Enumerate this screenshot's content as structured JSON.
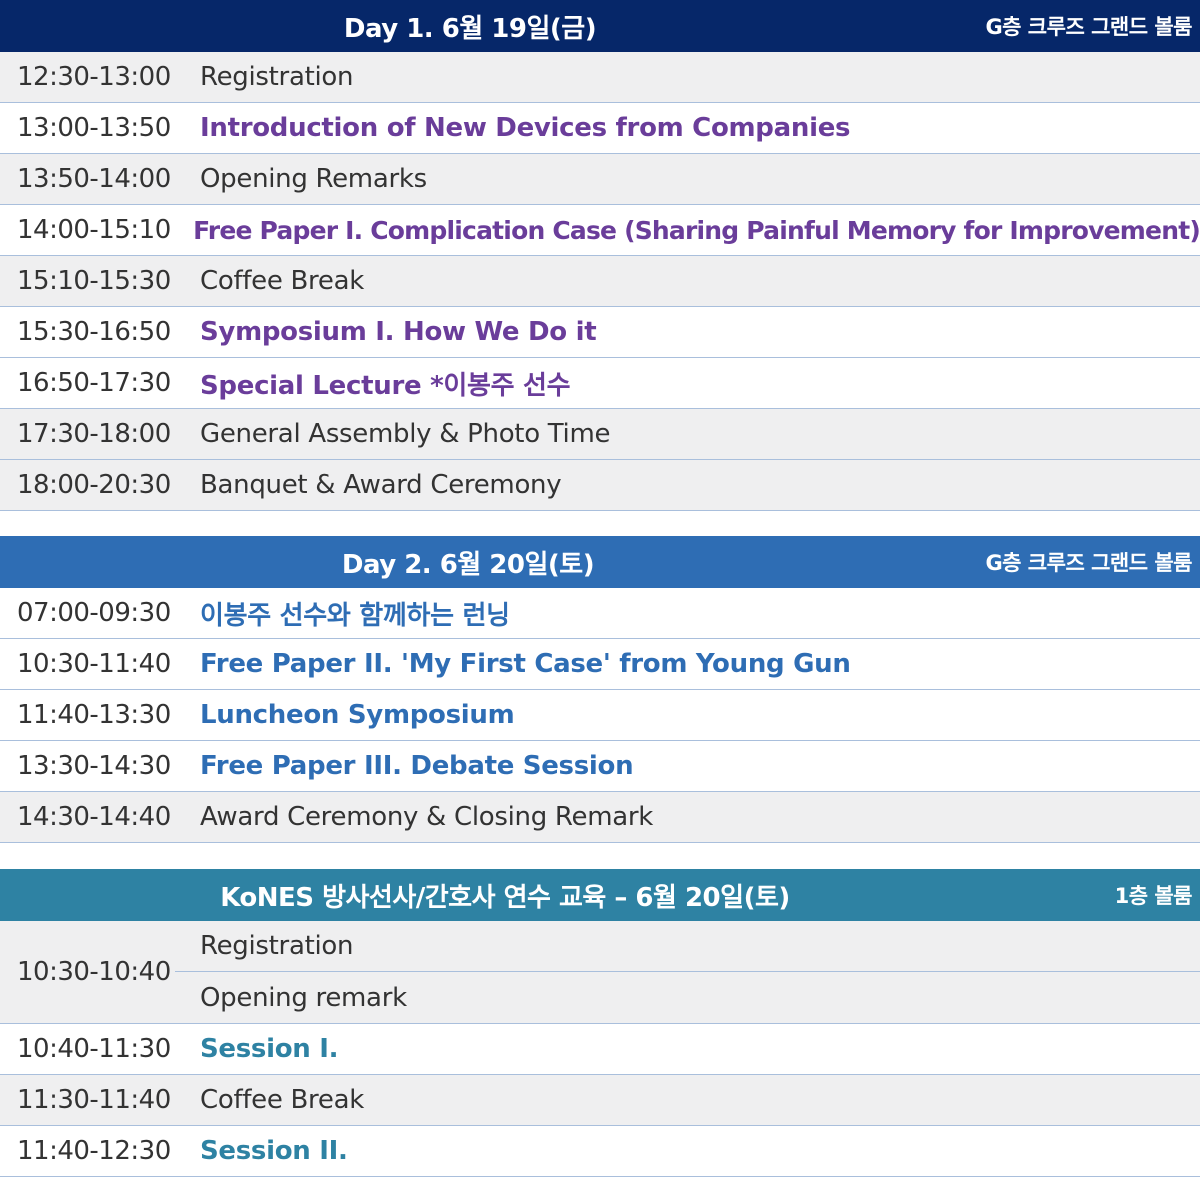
{
  "day1": {
    "title": "Day 1. 6월 19일(금)",
    "venue": "G층 크루즈 그랜드 볼룸",
    "rows": [
      {
        "time": "12:30-13:00",
        "label": "Registration"
      },
      {
        "time": "13:00-13:50",
        "label": "Introduction of New Devices from Companies"
      },
      {
        "time": "13:50-14:00",
        "label": "Opening Remarks"
      },
      {
        "time": "14:00-15:10",
        "label": "Free Paper I. Complication Case (Sharing Painful Memory for Improvement)"
      },
      {
        "time": "15:10-15:30",
        "label": "Coffee Break"
      },
      {
        "time": "15:30-16:50",
        "label": "Symposium I. How We Do it"
      },
      {
        "time": "16:50-17:30",
        "label": "Special Lecture *이봉주 선수"
      },
      {
        "time": "17:30-18:00",
        "label": "General Assembly & Photo Time"
      },
      {
        "time": "18:00-20:30",
        "label": "Banquet & Award Ceremony"
      }
    ]
  },
  "day2": {
    "title": "Day 2. 6월 20일(토)",
    "venue": "G층 크루즈 그랜드 볼룸",
    "rows": [
      {
        "time": "07:00-09:30",
        "label": "이봉주 선수와 함께하는 런닝"
      },
      {
        "time": "10:30-11:40",
        "label": "Free Paper II. 'My First Case' from Young Gun"
      },
      {
        "time": "11:40-13:30",
        "label": "Luncheon Symposium"
      },
      {
        "time": "13:30-14:30",
        "label": "Free Paper III. Debate Session"
      },
      {
        "time": "14:30-14:40",
        "label": "Award Ceremony & Closing Remark"
      }
    ]
  },
  "kones": {
    "title": "KoNES 방사선사/간호사 연수 교육 – 6월 20일(토)",
    "venue": "1층 볼룸",
    "group": {
      "time": "10:30-10:40",
      "labels": [
        "Registration",
        "Opening remark"
      ]
    },
    "rows": [
      {
        "time": "10:40-11:30",
        "label": "Session I."
      },
      {
        "time": "11:30-11:40",
        "label": "Coffee Break"
      },
      {
        "time": "11:40-12:30",
        "label": "Session II."
      }
    ]
  },
  "colors": {
    "day1_header": "#062769",
    "day2_header": "#2e6db4",
    "kones_header": "#2e82a3",
    "day1_highlight": "#6a3d9a",
    "day2_highlight": "#2e6db4",
    "kones_highlight": "#2e82a3",
    "row_alt": "#efeff0",
    "divider": "#a9bfdc"
  }
}
